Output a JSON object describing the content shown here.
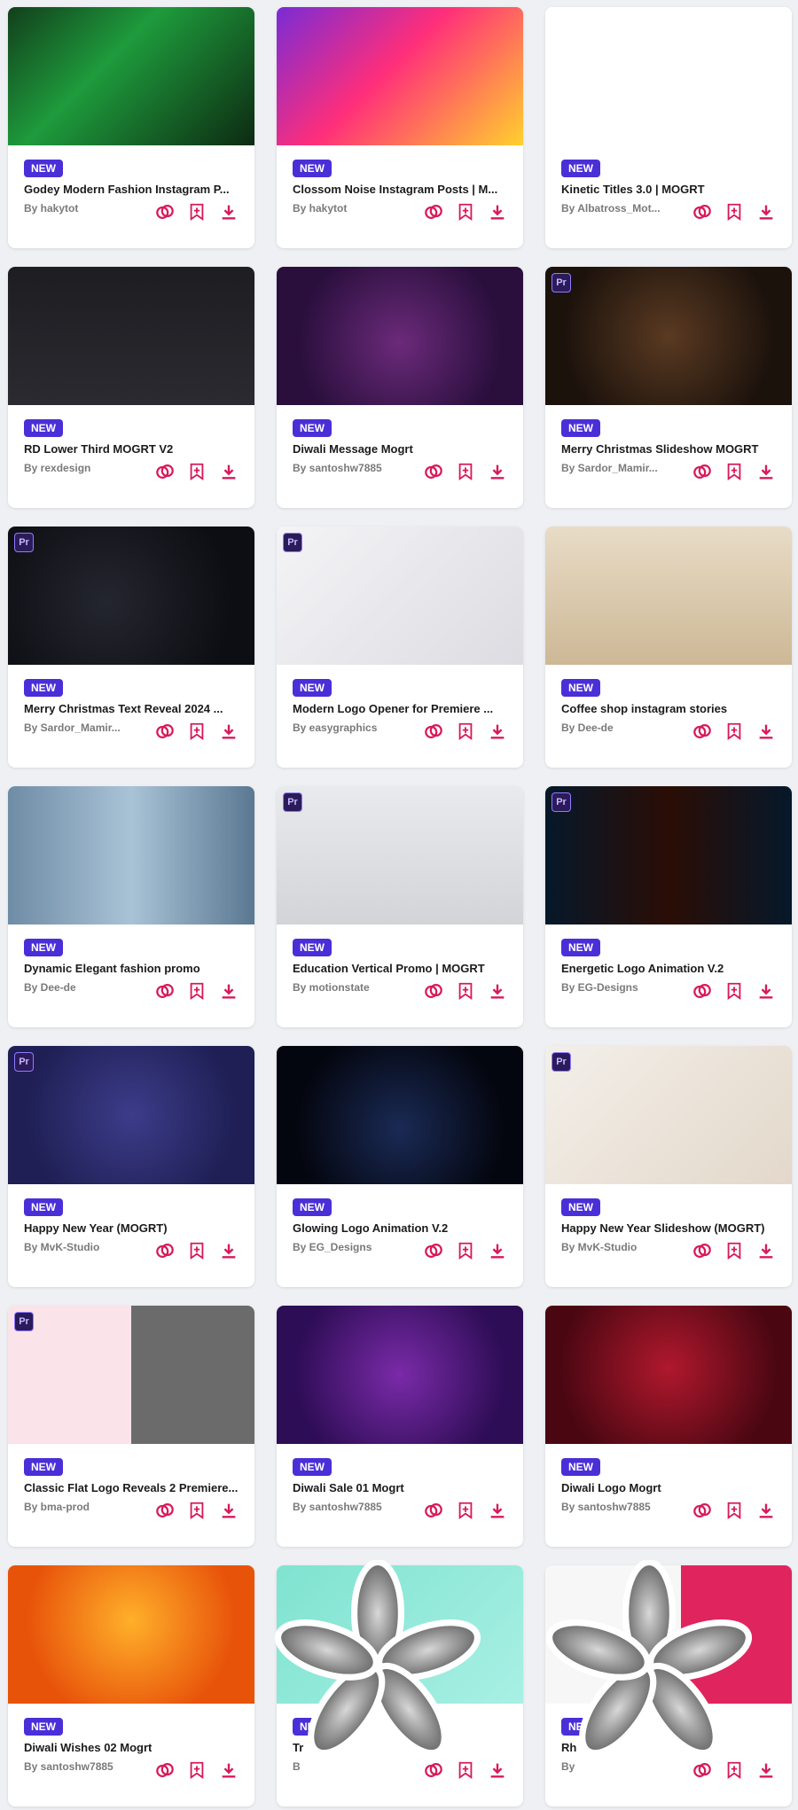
{
  "colors": {
    "accent": "#d8195a",
    "badge": "#4a2fd8"
  },
  "cards": [
    {
      "title": "Godey Modern Fashion Instagram P...",
      "author": "By hakytot",
      "badge": "NEW",
      "thumb_text": "",
      "bg": "linear-gradient(135deg,#123f1c,#1e9b3c 40%,#0d2a12)",
      "pr": false
    },
    {
      "title": "Clossom Noise Instagram Posts | M...",
      "author": "By hakytot",
      "badge": "NEW",
      "thumb_text": "",
      "bg": "linear-gradient(135deg,#7a2bd6,#ff2e7a 45%,#ffd02e)",
      "pr": false
    },
    {
      "title": "Kinetic Titles 3.0 | MOGRT",
      "author": "By Albatross_Mot...",
      "badge": "NEW",
      "thumb_text": "",
      "bg": "#ffffff",
      "pr": false
    },
    {
      "title": "RD Lower Third MOGRT V2",
      "author": "By rexdesign",
      "badge": "NEW",
      "thumb_text": "",
      "bg": "linear-gradient(180deg,#1d1d22,#2a2a30)",
      "pr": false
    },
    {
      "title": "Diwali Message Mogrt",
      "author": "By santoshw7885",
      "badge": "NEW",
      "thumb_text": "",
      "bg": "radial-gradient(circle at 50% 55%,#6b2a7a,#2a0f3d 70%)",
      "pr": false
    },
    {
      "title": "Merry Christmas Slideshow MOGRT",
      "author": "By Sardor_Mamir...",
      "badge": "NEW",
      "thumb_text": "",
      "bg": "radial-gradient(circle at 50% 50%,#5a3a22,#1c120c 75%)",
      "pr": true
    },
    {
      "title": "Merry Christmas Text Reveal 2024 ...",
      "author": "By Sardor_Mamir...",
      "badge": "NEW",
      "thumb_text": "",
      "bg": "radial-gradient(circle at 40% 55%,#24262f,#0d0e13 75%)",
      "pr": true
    },
    {
      "title": "Modern Logo Opener for Premiere ...",
      "author": "By easygraphics",
      "badge": "NEW",
      "thumb_text": "",
      "bg": "linear-gradient(135deg,#f4f4f6,#dcdce2)",
      "pr": true
    },
    {
      "title": "Coffee shop instagram stories",
      "author": "By Dee-de",
      "badge": "NEW",
      "thumb_text": "",
      "bg": "linear-gradient(180deg,#e8dcc6,#cdb896)",
      "pr": false
    },
    {
      "title": "Dynamic Elegant fashion promo",
      "author": "By Dee-de",
      "badge": "NEW",
      "thumb_text": "",
      "bg": "linear-gradient(90deg,#6f8ca6,#a9c3d6 50%,#5a7892)",
      "pr": false
    },
    {
      "title": "Education Vertical Promo | MOGRT",
      "author": "By motionstate",
      "badge": "NEW",
      "thumb_text": "",
      "bg": "linear-gradient(180deg,#e9eaec,#d2d4d8)",
      "pr": true
    },
    {
      "title": "Energetic Logo Animation V.2",
      "author": "By EG-Designs",
      "badge": "NEW",
      "thumb_text": "",
      "bg": "linear-gradient(90deg,#06182a,#2a0d05 50%,#06182a)",
      "pr": true
    },
    {
      "title": "Happy New Year (MOGRT)",
      "author": "By MvK-Studio",
      "badge": "NEW",
      "thumb_text": "",
      "bg": "radial-gradient(circle at 50% 50%,#3c3c8a,#1f1f55 75%)",
      "pr": true
    },
    {
      "title": "Glowing Logo Animation V.2",
      "author": "By EG_Designs",
      "badge": "NEW",
      "thumb_text": "",
      "bg": "radial-gradient(circle at 50% 60%,#1a2a55,#04060f 70%)",
      "pr": false
    },
    {
      "title": "Happy New Year Slideshow (MOGRT)",
      "author": "By MvK-Studio",
      "badge": "NEW",
      "thumb_text": "",
      "bg": "linear-gradient(135deg,#f3efe9,#e3d8ca)",
      "pr": true
    },
    {
      "title": "Classic Flat Logo Reveals 2 Premiere...",
      "author": "By bma-prod",
      "badge": "NEW",
      "thumb_text": "",
      "bg": "linear-gradient(90deg,#fbe3ea 50%,#6b6b6b 50%)",
      "pr": true
    },
    {
      "title": "Diwali Sale 01 Mogrt",
      "author": "By santoshw7885",
      "badge": "NEW",
      "thumb_text": "",
      "bg": "radial-gradient(circle at 50% 50%,#7a2aa8,#2d0d55 75%)",
      "pr": false
    },
    {
      "title": "Diwali Logo Mogrt",
      "author": "By santoshw7885",
      "badge": "NEW",
      "thumb_text": "",
      "bg": "radial-gradient(circle at 50% 45%,#b0182d,#4a0712 75%)",
      "pr": false
    },
    {
      "title": "Diwali Wishes 02 Mogrt",
      "author": "By santoshw7885",
      "badge": "NEW",
      "thumb_text": "",
      "bg": "radial-gradient(circle at 50% 40%,#ffb02a,#e8530a 70%)",
      "pr": false
    },
    {
      "title": "Tr",
      "author": "B",
      "badge": "NEW",
      "thumb_text": "",
      "bg": "linear-gradient(135deg,#7fe3d0,#a8f0e4)",
      "pr": false
    },
    {
      "title": "Rh",
      "author": "By",
      "badge": "NEW",
      "thumb_text": "",
      "bg": "linear-gradient(90deg,#f7f7f7 55%,#e0245e 55%)",
      "pr": false
    }
  ]
}
